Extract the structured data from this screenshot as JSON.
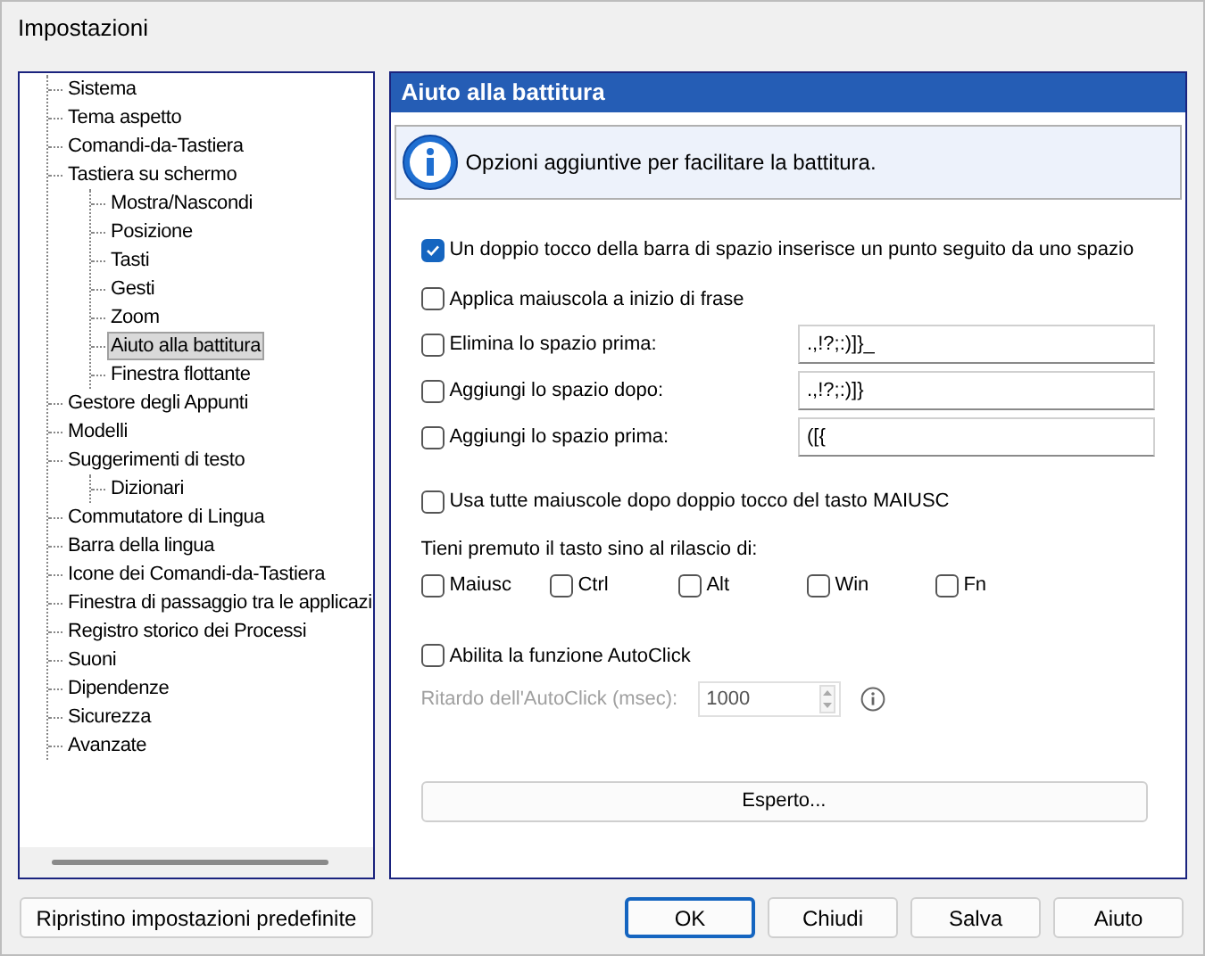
{
  "window": {
    "title": "Impostazioni"
  },
  "tree": {
    "items": [
      {
        "label": "Sistema",
        "selected": false
      },
      {
        "label": "Tema aspetto",
        "selected": false
      },
      {
        "label": "Comandi-da-Tastiera",
        "selected": false
      },
      {
        "label": "Tastiera su schermo",
        "selected": false,
        "children": [
          {
            "label": "Mostra/Nascondi",
            "selected": false
          },
          {
            "label": "Posizione",
            "selected": false
          },
          {
            "label": "Tasti",
            "selected": false
          },
          {
            "label": "Gesti",
            "selected": false
          },
          {
            "label": "Zoom",
            "selected": false
          },
          {
            "label": "Aiuto alla battitura",
            "selected": true
          },
          {
            "label": "Finestra flottante",
            "selected": false
          }
        ]
      },
      {
        "label": "Gestore degli Appunti",
        "selected": false
      },
      {
        "label": "Modelli",
        "selected": false
      },
      {
        "label": "Suggerimenti di testo",
        "selected": false,
        "children": [
          {
            "label": "Dizionari",
            "selected": false
          }
        ]
      },
      {
        "label": "Commutatore di Lingua",
        "selected": false
      },
      {
        "label": "Barra della lingua",
        "selected": false
      },
      {
        "label": "Icone dei Comandi-da-Tastiera",
        "selected": false
      },
      {
        "label": "Finestra di passaggio tra le applicazi",
        "selected": false
      },
      {
        "label": "Registro storico dei Processi",
        "selected": false
      },
      {
        "label": "Suoni",
        "selected": false
      },
      {
        "label": "Dipendenze",
        "selected": false
      },
      {
        "label": "Sicurezza",
        "selected": false
      },
      {
        "label": "Avanzate",
        "selected": false
      }
    ]
  },
  "panel": {
    "title": "Aiuto alla battitura",
    "info": "Opzioni aggiuntive per facilitare la battitura.",
    "checks": [
      {
        "label": "Un doppio tocco della barra di spazio inserisce un punto seguito da uno spazio",
        "checked": true
      },
      {
        "label": "Applica maiuscola a inizio di frase",
        "checked": false
      }
    ],
    "space_fields": [
      {
        "label": "Elimina lo spazio prima:",
        "checked": false,
        "value": ".,!?;:)]}_"
      },
      {
        "label": "Aggiungi lo spazio dopo:",
        "checked": false,
        "value": ".,!?;:)]}"
      },
      {
        "label": "Aggiungi lo spazio prima:",
        "checked": false,
        "value": "([{"
      }
    ],
    "caps_lock": {
      "label": "Usa tutte maiuscole dopo doppio tocco del tasto MAIUSC",
      "checked": false
    },
    "hold_label": "Tieni premuto il tasto sino al rilascio di:",
    "hold_keys": [
      {
        "label": "Maiusc",
        "checked": false
      },
      {
        "label": "Ctrl",
        "checked": false
      },
      {
        "label": "Alt",
        "checked": false
      },
      {
        "label": "Win",
        "checked": false
      },
      {
        "label": "Fn",
        "checked": false
      }
    ],
    "autoclick": {
      "label": "Abilita la funzione AutoClick",
      "checked": false
    },
    "delay": {
      "label": "Ritardo dell'AutoClick (msec):",
      "value": "1000",
      "disabled": true
    },
    "expert_button": "Esperto..."
  },
  "footer": {
    "reset_button": "Ripristino impostazioni predefinite",
    "buttons": [
      {
        "label": "OK",
        "default": true
      },
      {
        "label": "Chiudi",
        "default": false
      },
      {
        "label": "Salva",
        "default": false
      },
      {
        "label": "Aiuto",
        "default": false
      }
    ]
  }
}
